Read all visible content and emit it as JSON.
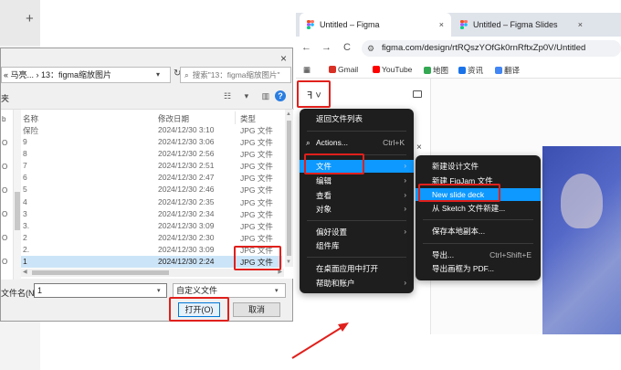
{
  "bg": {
    "plus": "+"
  },
  "dialog": {
    "close": "×",
    "address": "« 马亮... › 13：figma缩放图片",
    "search_placeholder": "搜索\"13：figma缩放图片\"",
    "toolbar_left": "夹",
    "view_icons": "☷ ▾ ▥",
    "help": "?",
    "columns": {
      "name": "名称",
      "date": "修改日期",
      "type": "类型"
    },
    "nav_letters": [
      "b",
      "O",
      "O",
      "O",
      "O",
      "O",
      "O"
    ],
    "rows": [
      {
        "name": "保险",
        "date": "2024/12/30 3:10",
        "type": "JPG 文件"
      },
      {
        "name": "9",
        "date": "2024/12/30 3:06",
        "type": "JPG 文件"
      },
      {
        "name": "8",
        "date": "2024/12/30 2:56",
        "type": "JPG 文件"
      },
      {
        "name": "7",
        "date": "2024/12/30 2:51",
        "type": "JPG 文件"
      },
      {
        "name": "6",
        "date": "2024/12/30 2:47",
        "type": "JPG 文件"
      },
      {
        "name": "5",
        "date": "2024/12/30 2:46",
        "type": "JPG 文件"
      },
      {
        "name": "4",
        "date": "2024/12/30 2:35",
        "type": "JPG 文件"
      },
      {
        "name": "3",
        "date": "2024/12/30 2:34",
        "type": "JPG 文件"
      },
      {
        "name": "3.",
        "date": "2024/12/30 3:09",
        "type": "JPG 文件"
      },
      {
        "name": "2",
        "date": "2024/12/30 2:30",
        "type": "JPG 文件"
      },
      {
        "name": "2.",
        "date": "2024/12/30 3:09",
        "type": "JPG 文件"
      },
      {
        "name": "1",
        "date": "2024/12/30 2:24",
        "type": "JPG 文件"
      }
    ],
    "filename_label": "文件名(N):",
    "filename_value": "1",
    "filetype_value": "自定义文件",
    "open_button": "打开(O)",
    "cancel_button": "取消"
  },
  "browser": {
    "tabs": [
      {
        "title": "Untitled – Figma",
        "close": "×"
      },
      {
        "title": "Untitled – Figma Slides",
        "close": "×"
      }
    ],
    "nav": {
      "back": "←",
      "forward": "→",
      "reload": "C"
    },
    "url": "figma.com/design/rtRQszYOfGk0rnRftxZp0V/Untitled",
    "url_icon": "⚙",
    "bookmarks": [
      "Gmail",
      "YouTube",
      "地图",
      "资讯",
      "翻译"
    ],
    "bookmark_colors": [
      "#d93025",
      "#ff0000",
      "#34a853",
      "#1a73e8",
      "#4285f4"
    ],
    "apps_icon": "▦",
    "figma_menu": "ꟻ ˅",
    "panel_close": "×"
  },
  "main_menu": [
    {
      "label": "返回文件列表",
      "shortcut": "",
      "arrow": ""
    },
    {
      "label": "Actions...",
      "shortcut": "Ctrl+K",
      "arrow": "",
      "icon": "⌕"
    },
    {
      "label": "文件",
      "shortcut": "",
      "arrow": "›",
      "highlight": true
    },
    {
      "label": "编辑",
      "shortcut": "",
      "arrow": "›"
    },
    {
      "label": "查看",
      "shortcut": "",
      "arrow": "›"
    },
    {
      "label": "对象",
      "shortcut": "",
      "arrow": "›"
    },
    {
      "label": "偏好设置",
      "shortcut": "",
      "arrow": "›"
    },
    {
      "label": "组件库",
      "shortcut": "",
      "arrow": ""
    },
    {
      "label": "在桌面应用中打开",
      "shortcut": "",
      "arrow": ""
    },
    {
      "label": "帮助和账户",
      "shortcut": "",
      "arrow": "›"
    }
  ],
  "file_menu": [
    {
      "label": "新建设计文件",
      "shortcut": ""
    },
    {
      "label": "新建 FigJam 文件",
      "shortcut": ""
    },
    {
      "label": "New slide deck",
      "shortcut": "",
      "highlight": true
    },
    {
      "label": "从 Sketch 文件新建...",
      "shortcut": ""
    },
    {
      "label": "保存本地副本...",
      "shortcut": ""
    },
    {
      "label": "导出...",
      "shortcut": "Ctrl+Shift+E"
    },
    {
      "label": "导出画框为 PDF...",
      "shortcut": ""
    }
  ],
  "colors": {
    "annotation_red": "#e0201c",
    "menu_bg": "#1e1e1e",
    "menu_highlight": "#0d99ff"
  }
}
